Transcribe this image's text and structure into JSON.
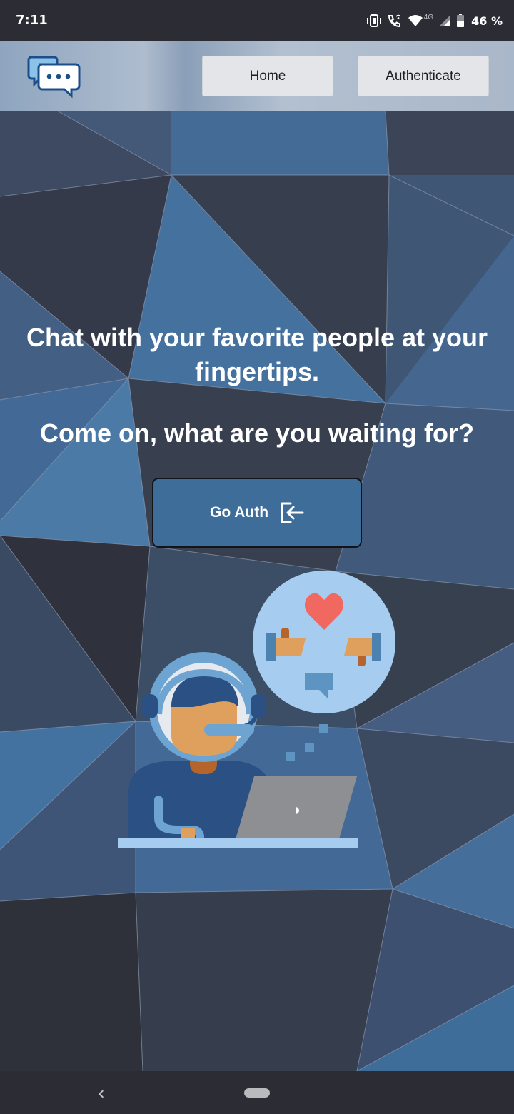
{
  "status_bar": {
    "time": "7:11",
    "network_label": "4G",
    "battery_percent": "46 %",
    "icons": [
      "vibrate-icon",
      "wifi-call-icon",
      "wifi-icon",
      "signal-icon",
      "battery-icon"
    ]
  },
  "header": {
    "logo_icon": "chat-bubbles-icon",
    "nav": {
      "home_label": "Home",
      "authenticate_label": "Authenticate"
    }
  },
  "hero": {
    "line1": "Chat with your favorite people at your fingertips.",
    "line2": "Come on, what are you waiting for?",
    "cta_label": "Go Auth",
    "cta_icon": "login-icon"
  },
  "illustration": {
    "name": "support-agent-illustration",
    "elements": [
      "heart-icon",
      "thumbs-up-icon",
      "thumbs-down-icon",
      "speech-bubble-icon",
      "laptop-icon",
      "headset-icon"
    ]
  },
  "colors": {
    "header_bg": "#aebcce",
    "button_bg": "#3f6d9a",
    "bg_dark": "#353b4a",
    "bg_blue": "#426b93",
    "thought_bubble": "#a6cdf0",
    "heart": "#f06860"
  }
}
